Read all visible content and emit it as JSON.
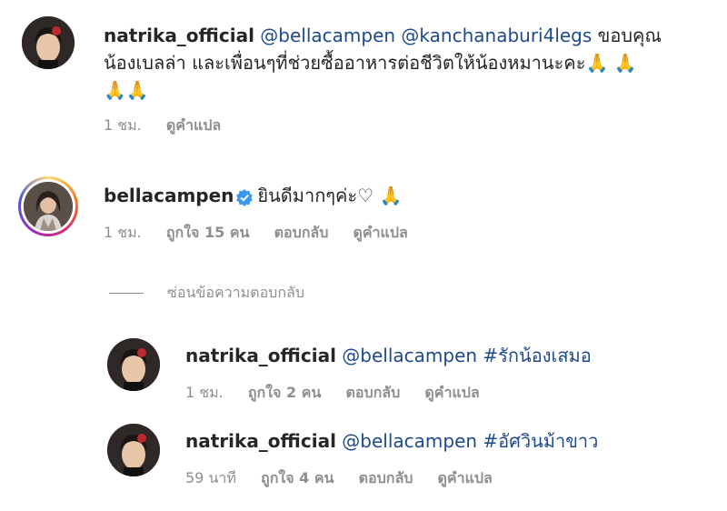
{
  "comments": [
    {
      "username": "natrika_official",
      "mention1": "@bellacampen",
      "mention2": "@kanchanaburi4legs",
      "text_line1_tail": "ขอบคุณ",
      "text_line2": "น้องเบลล่า และเพื่อนๆที่ช่วยซื้ออาหารต่อชีวิตให้น้องหมานะคะ",
      "emoji_line2": "🙏 🙏",
      "emoji_line3": "🙏🙏",
      "time": "1 ชม.",
      "translate": "ดูคำแปล"
    },
    {
      "username": "bellacampen",
      "text": "ยินดีมากๆค่ะ♡",
      "emoji": "🙏",
      "time": "1 ชม.",
      "likes": "ถูกใจ 15 คน",
      "reply": "ตอบกลับ",
      "translate": "ดูคำแปล"
    }
  ],
  "hide_replies_label": "ซ่อนข้อความตอบกลับ",
  "replies": [
    {
      "username": "natrika_official",
      "mention": "@bellacampen",
      "hashtag": "#รักน้องเสมอ",
      "time": "1 ชม.",
      "likes": "ถูกใจ 2 คน",
      "reply": "ตอบกลับ",
      "translate": "ดูคำแปล"
    },
    {
      "username": "natrika_official",
      "mention": "@bellacampen",
      "hashtag": "#อัศวินม้าขาว",
      "time": "59 นาที",
      "likes": "ถูกใจ 4 คน",
      "reply": "ตอบกลับ",
      "translate": "ดูคำแปล"
    }
  ],
  "colors": {
    "mention": "#1f4a8a",
    "meta": "#8e8e8e",
    "verified": "#3897f0"
  }
}
